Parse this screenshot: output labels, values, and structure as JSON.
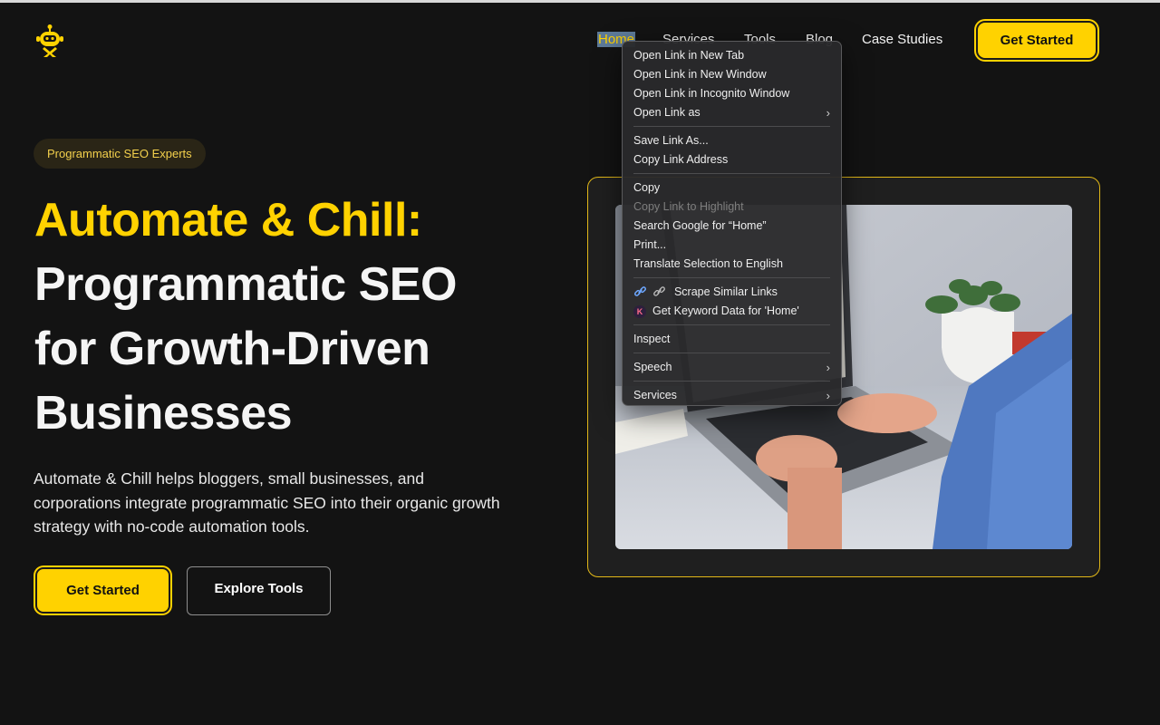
{
  "nav": {
    "home": "Home",
    "services": "Services",
    "tools": "Tools",
    "blog": "Blog",
    "case_studies": "Case Studies",
    "cta": "Get Started"
  },
  "hero": {
    "badge": "Programmatic SEO Experts",
    "title_line1": "Automate & Chill:",
    "title_line2": "Programmatic SEO",
    "title_line3": "for Growth-Driven",
    "title_line4": "Businesses",
    "description": "Automate & Chill helps bloggers, small businesses, and corporations integrate programmatic SEO into their organic growth strategy with no-code automation tools.",
    "primary_button": "Get Started",
    "secondary_button": "Explore Tools"
  },
  "context_menu": {
    "open_new_tab": "Open Link in New Tab",
    "open_new_window": "Open Link in New Window",
    "open_incognito": "Open Link in Incognito Window",
    "open_link_as": "Open Link as",
    "save_link_as": "Save Link As...",
    "copy_link_address": "Copy Link Address",
    "copy": "Copy",
    "copy_link_highlight": "Copy Link to Highlight",
    "search_google": "Search Google for “Home”",
    "print": "Print...",
    "translate": "Translate Selection to English",
    "scrape_similar": "Scrape Similar Links",
    "keyword_data": "Get Keyword Data for 'Home'",
    "keyword_icon_letter": "K",
    "inspect": "Inspect",
    "speech": "Speech",
    "services": "Services"
  },
  "colors": {
    "accent": "#ffd200",
    "background": "#131313"
  }
}
